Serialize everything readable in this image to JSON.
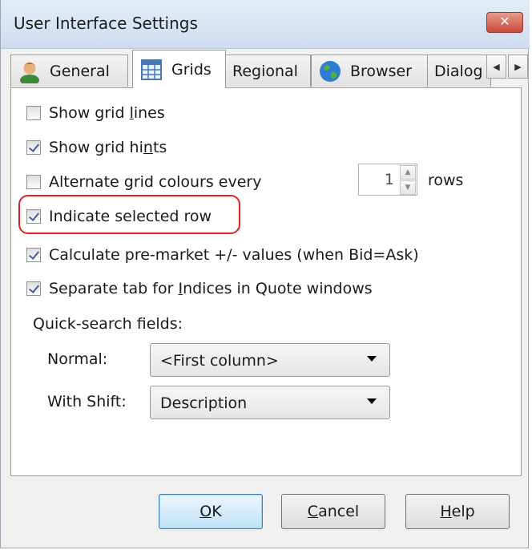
{
  "window": {
    "title": "User Interface Settings",
    "close_label": "✕"
  },
  "tabs": [
    {
      "label": "General",
      "icon": "user-icon"
    },
    {
      "label": "Grids",
      "icon": "grid-icon",
      "active": true
    },
    {
      "label": "Regional"
    },
    {
      "label": "Browser",
      "icon": "globe-icon"
    },
    {
      "label": "Dialog"
    }
  ],
  "tab_scroll": {
    "left": "◀",
    "right": "▶"
  },
  "options": [
    {
      "label_pre": "Show grid ",
      "label_key": "l",
      "label_post": "ines",
      "checked": false
    },
    {
      "label_pre": "Show grid hi",
      "label_key": "n",
      "label_post": "ts",
      "checked": true
    },
    {
      "label_pre": "Alternate grid colours every",
      "label_key": "",
      "label_post": "",
      "checked": false
    },
    {
      "label_pre": "Indicate selected row",
      "label_key": "",
      "label_post": "",
      "checked": true
    },
    {
      "label_pre": "Calculate pre-market +/- values (when Bid=Ask)",
      "label_key": "",
      "label_post": "",
      "checked": true
    },
    {
      "label_pre": "Separate tab for ",
      "label_key": "I",
      "label_post": "ndices in Quote windows",
      "checked": true
    }
  ],
  "alternate_rows": {
    "value": "1",
    "unit": "rows",
    "up": "▲",
    "down": "▼"
  },
  "quick_search": {
    "heading": "Quick-search fields:",
    "normal_label": "Normal:",
    "normal_value": "<First column>",
    "shift_label": "With Shift:",
    "shift_value": "Description"
  },
  "buttons": {
    "ok_key": "O",
    "ok_rest": "K",
    "cancel_key": "C",
    "cancel_rest": "ancel",
    "help_key": "H",
    "help_rest": "elp"
  },
  "colors": {
    "highlight": "#e11f26",
    "check": "#3e5fa8"
  }
}
